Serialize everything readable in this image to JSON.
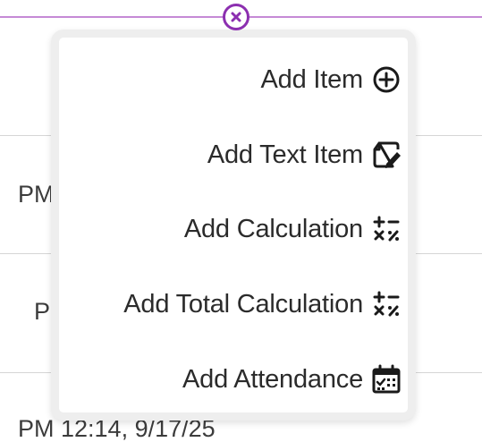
{
  "background": {
    "rows": [
      {
        "text": "PM"
      },
      {
        "text": "PM"
      },
      {
        "text": "PM 12:14, 9/17/25"
      }
    ]
  },
  "close_button": {
    "icon": "close-icon",
    "color": "#8c2fb0"
  },
  "menu": {
    "items": [
      {
        "label": "Add Item",
        "icon": "plus-circle-icon"
      },
      {
        "label": "Add Text Item",
        "icon": "text-item-icon"
      },
      {
        "label": "Add Calculation",
        "icon": "calculation-icon"
      },
      {
        "label": "Add Total Calculation",
        "icon": "calculation-icon"
      },
      {
        "label": "Add Attendance",
        "icon": "attendance-calendar-icon"
      }
    ]
  },
  "colors": {
    "accent": "#8c2fb0",
    "divider": "#d6d6d6",
    "text": "#2b2b2b"
  }
}
